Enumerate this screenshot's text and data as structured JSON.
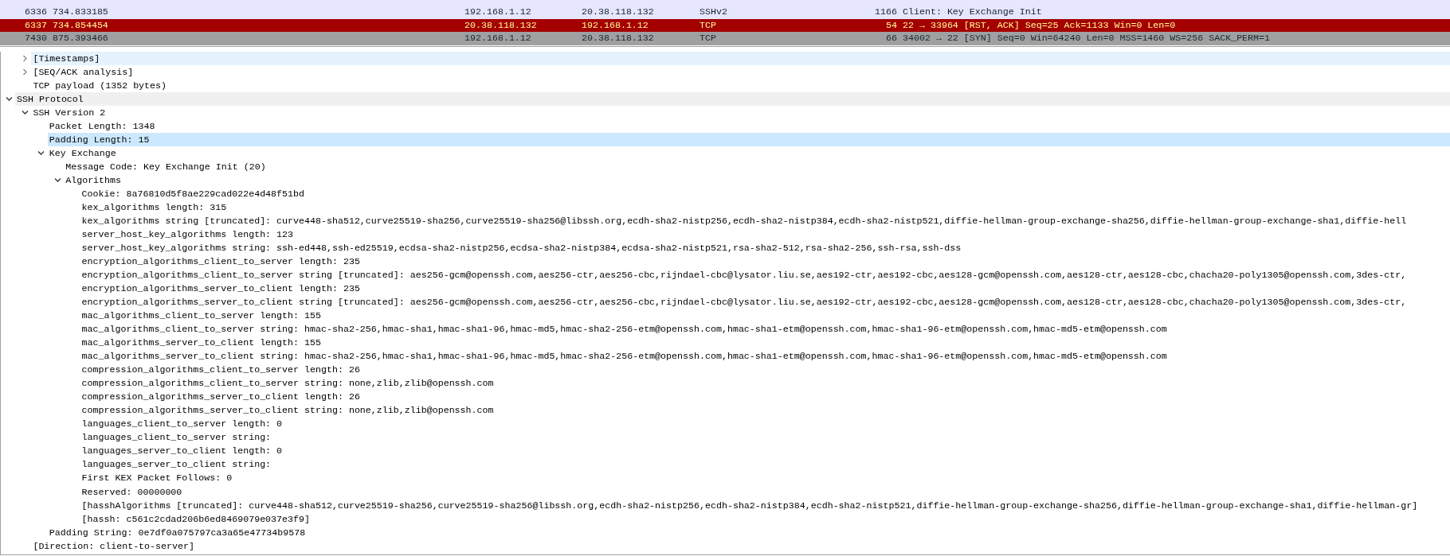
{
  "packets": [
    {
      "number": "6336",
      "time": "734.833185",
      "source": "192.168.1.12",
      "destination": "20.38.118.132",
      "protocol": "SSHv2",
      "length": "1166",
      "info": "Client: Key Exchange Init",
      "color": "#e7e6ff"
    },
    {
      "number": "6337",
      "time": "734.854454",
      "source": "20.38.118.132",
      "destination": "192.168.1.12",
      "protocol": "TCP",
      "length": "54",
      "info": "22 → 33964 [RST, ACK] Seq=25 Ack=1133 Win=0 Len=0",
      "color": "#a40000"
    },
    {
      "number": "7430",
      "time": "875.393466",
      "source": "192.168.1.12",
      "destination": "20.38.118.132",
      "protocol": "TCP",
      "length": "66",
      "info": "34002 → 22 [SYN] Seq=0 Win=64240 Len=0 MSS=1460 WS=256 SACK_PERM=1",
      "color": "#a0a0a0"
    }
  ],
  "tree": [
    {
      "children": [
        {
          "label": "[Timestamps]",
          "expanded": false,
          "selected": false,
          "hovered": true
        },
        {
          "label": "[SEQ/ACK analysis]",
          "expanded": false,
          "selected": false
        },
        {
          "label": "TCP payload (1352 bytes)",
          "selected": false
        }
      ]
    },
    {
      "label": "SSH Protocol",
      "expanded": true,
      "selected": false,
      "highlighted": true,
      "children": [
        {
          "label": "SSH Version 2",
          "expanded": true,
          "selected": false,
          "children": [
            {
              "label": "Packet Length: 1348",
              "selected": false
            },
            {
              "label": "Padding Length: 15",
              "selected": true
            },
            {
              "label": "Key Exchange",
              "expanded": true,
              "selected": false,
              "children": [
                {
                  "label": "Message Code: Key Exchange Init (20)",
                  "selected": false
                },
                {
                  "label": "Algorithms",
                  "expanded": true,
                  "selected": false,
                  "children": [
                    {
                      "label": "Cookie: 8a76810d5f8ae229cad022e4d48f51bd",
                      "selected": false
                    },
                    {
                      "label": "kex_algorithms length: 315",
                      "selected": false
                    },
                    {
                      "label": "kex_algorithms string [truncated]: curve448-sha512,curve25519-sha256,curve25519-sha256@libssh.org,ecdh-sha2-nistp256,ecdh-sha2-nistp384,ecdh-sha2-nistp521,diffie-hellman-group-exchange-sha256,diffie-hellman-group-exchange-sha1,diffie-hell",
                      "selected": false
                    },
                    {
                      "label": "server_host_key_algorithms length: 123",
                      "selected": false
                    },
                    {
                      "label": "server_host_key_algorithms string: ssh-ed448,ssh-ed25519,ecdsa-sha2-nistp256,ecdsa-sha2-nistp384,ecdsa-sha2-nistp521,rsa-sha2-512,rsa-sha2-256,ssh-rsa,ssh-dss",
                      "selected": false
                    },
                    {
                      "label": "encryption_algorithms_client_to_server length: 235",
                      "selected": false
                    },
                    {
                      "label": "encryption_algorithms_client_to_server string [truncated]: aes256-gcm@openssh.com,aes256-ctr,aes256-cbc,rijndael-cbc@lysator.liu.se,aes192-ctr,aes192-cbc,aes128-gcm@openssh.com,aes128-ctr,aes128-cbc,chacha20-poly1305@openssh.com,3des-ctr,",
                      "selected": false
                    },
                    {
                      "label": "encryption_algorithms_server_to_client length: 235",
                      "selected": false
                    },
                    {
                      "label": "encryption_algorithms_server_to_client string [truncated]: aes256-gcm@openssh.com,aes256-ctr,aes256-cbc,rijndael-cbc@lysator.liu.se,aes192-ctr,aes192-cbc,aes128-gcm@openssh.com,aes128-ctr,aes128-cbc,chacha20-poly1305@openssh.com,3des-ctr,",
                      "selected": false
                    },
                    {
                      "label": "mac_algorithms_client_to_server length: 155",
                      "selected": false
                    },
                    {
                      "label": "mac_algorithms_client_to_server string: hmac-sha2-256,hmac-sha1,hmac-sha1-96,hmac-md5,hmac-sha2-256-etm@openssh.com,hmac-sha1-etm@openssh.com,hmac-sha1-96-etm@openssh.com,hmac-md5-etm@openssh.com",
                      "selected": false
                    },
                    {
                      "label": "mac_algorithms_server_to_client length: 155",
                      "selected": false
                    },
                    {
                      "label": "mac_algorithms_server_to_client string: hmac-sha2-256,hmac-sha1,hmac-sha1-96,hmac-md5,hmac-sha2-256-etm@openssh.com,hmac-sha1-etm@openssh.com,hmac-sha1-96-etm@openssh.com,hmac-md5-etm@openssh.com",
                      "selected": false
                    },
                    {
                      "label": "compression_algorithms_client_to_server length: 26",
                      "selected": false
                    },
                    {
                      "label": "compression_algorithms_client_to_server string: none,zlib,zlib@openssh.com",
                      "selected": false
                    },
                    {
                      "label": "compression_algorithms_server_to_client length: 26",
                      "selected": false
                    },
                    {
                      "label": "compression_algorithms_server_to_client string: none,zlib,zlib@openssh.com",
                      "selected": false
                    },
                    {
                      "label": "languages_client_to_server length: 0",
                      "selected": false
                    },
                    {
                      "label": "languages_client_to_server string:",
                      "selected": false
                    },
                    {
                      "label": "languages_server_to_client length: 0",
                      "selected": false
                    },
                    {
                      "label": "languages_server_to_client string:",
                      "selected": false
                    },
                    {
                      "label": "First KEX Packet Follows: 0",
                      "selected": false
                    },
                    {
                      "label": "Reserved: 00000000",
                      "selected": false
                    },
                    {
                      "label": "[hasshAlgorithms [truncated]: curve448-sha512,curve25519-sha256,curve25519-sha256@libssh.org,ecdh-sha2-nistp256,ecdh-sha2-nistp384,ecdh-sha2-nistp521,diffie-hellman-group-exchange-sha256,diffie-hellman-group-exchange-sha1,diffie-hellman-gr]",
                      "selected": false
                    },
                    {
                      "label": "[hassh: c561c2cdad206b6ed8469079e037e3f9]",
                      "selected": false
                    }
                  ]
                }
              ]
            },
            {
              "label": "Padding String: 0e7df0a075797ca3a65e47734b9578",
              "selected": false
            }
          ]
        },
        {
          "label": "[Direction: client-to-server]",
          "selected": false
        }
      ]
    }
  ]
}
